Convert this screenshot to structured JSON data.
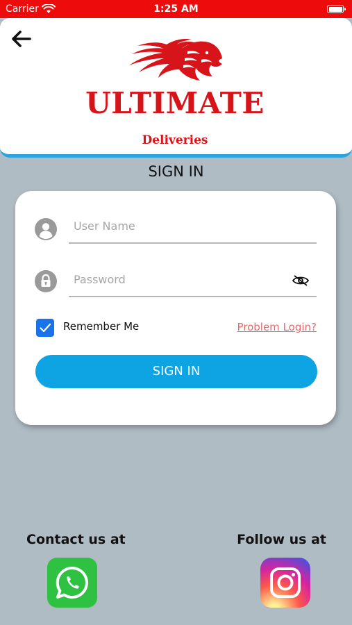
{
  "status_bar": {
    "carrier": "Carrier",
    "time": "1:25 AM"
  },
  "header": {
    "brand_title": "ULTIMATE",
    "brand_subtitle": "Deliveries"
  },
  "page_title": "SIGN IN",
  "login_form": {
    "username_placeholder": "User Name",
    "username_value": "",
    "password_placeholder": "Password",
    "password_value": "",
    "remember_me_label": "Remember Me",
    "remember_me_checked": true,
    "problem_login_label": "Problem Login?",
    "signin_button_label": "SIGN IN"
  },
  "footer": {
    "contact_label": "Contact us at",
    "follow_label": "Follow us at"
  },
  "colors": {
    "status_bar": "#ee0b0b",
    "brand_red": "#d8141b",
    "accent_blue": "#0ea3e2",
    "background": "#b0bcc4",
    "link": "#e36b6b"
  },
  "icons": [
    "back-arrow-icon",
    "lion-logo-icon",
    "user-icon",
    "lock-icon",
    "eye-icon",
    "checkmark-icon",
    "whatsapp-icon",
    "instagram-icon",
    "wifi-icon",
    "battery-icon"
  ]
}
